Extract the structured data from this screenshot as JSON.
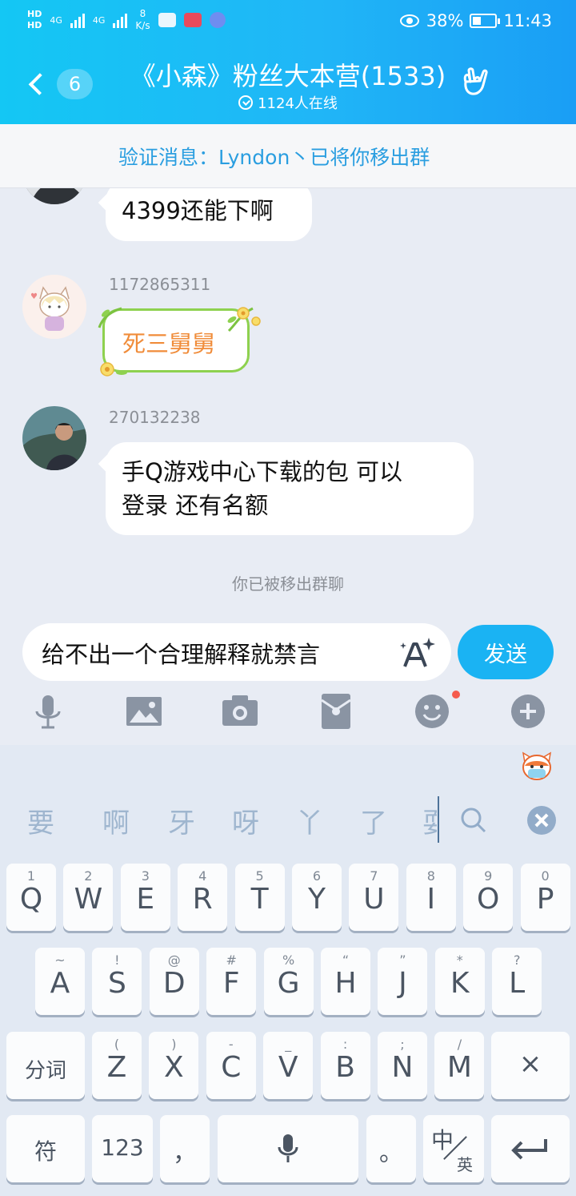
{
  "status_bar": {
    "hd_top": "HD",
    "hd_bottom": "HD",
    "net_a": "4G",
    "net_b": "4G",
    "speed_value": "8",
    "speed_unit": "K/s",
    "battery": "38%",
    "time": "11:43",
    "battery_level": 0.38
  },
  "header": {
    "unread_count": "6",
    "title": "《小森》粉丝大本营(1533)",
    "online": "1124人在线"
  },
  "banner": {
    "text": "验证消息：Lyndon丶已将你移出群"
  },
  "messages": [
    {
      "sender": "",
      "text": "4399还能下啊"
    },
    {
      "sender": "1172865311",
      "text": "死三舅舅"
    },
    {
      "sender": "270132238",
      "line1": "手Q游戏中心下载的包 可以",
      "line2": "登录  还有名额"
    }
  ],
  "system_notice": "你已被移出群聊",
  "input": {
    "value": "给不出一个合理解释就禁言",
    "send_label": "发送"
  },
  "toolbar": {
    "icons": [
      "microphone-icon",
      "image-icon",
      "camera-icon",
      "red-packet-icon",
      "emoji-icon",
      "plus-icon"
    ]
  },
  "keyboard": {
    "candidates": [
      "要",
      "啊",
      "牙",
      "呀",
      "丫",
      "了",
      "耍"
    ],
    "row1": [
      {
        "main": "Q",
        "sub": "1"
      },
      {
        "main": "W",
        "sub": "2"
      },
      {
        "main": "E",
        "sub": "3"
      },
      {
        "main": "R",
        "sub": "4"
      },
      {
        "main": "T",
        "sub": "5"
      },
      {
        "main": "Y",
        "sub": "6"
      },
      {
        "main": "U",
        "sub": "7"
      },
      {
        "main": "I",
        "sub": "8"
      },
      {
        "main": "O",
        "sub": "9"
      },
      {
        "main": "P",
        "sub": "0"
      }
    ],
    "row2": [
      {
        "main": "A",
        "sub": "~"
      },
      {
        "main": "S",
        "sub": "!"
      },
      {
        "main": "D",
        "sub": "@"
      },
      {
        "main": "F",
        "sub": "#"
      },
      {
        "main": "G",
        "sub": "%"
      },
      {
        "main": "H",
        "sub": "“"
      },
      {
        "main": "J",
        "sub": "”"
      },
      {
        "main": "K",
        "sub": "*"
      },
      {
        "main": "L",
        "sub": "?"
      }
    ],
    "row3": [
      {
        "main": "Z",
        "sub": "("
      },
      {
        "main": "X",
        "sub": ")"
      },
      {
        "main": "C",
        "sub": "-"
      },
      {
        "main": "V",
        "sub": "_"
      },
      {
        "main": "B",
        "sub": ":"
      },
      {
        "main": "N",
        "sub": ";"
      },
      {
        "main": "M",
        "sub": "/"
      }
    ],
    "segment_key": "分词",
    "delete_key": "×",
    "symbol_key": "符",
    "number_key": "123",
    "comma_key": "，",
    "period_key": "。",
    "lang_zh": "中",
    "lang_en": "英"
  }
}
